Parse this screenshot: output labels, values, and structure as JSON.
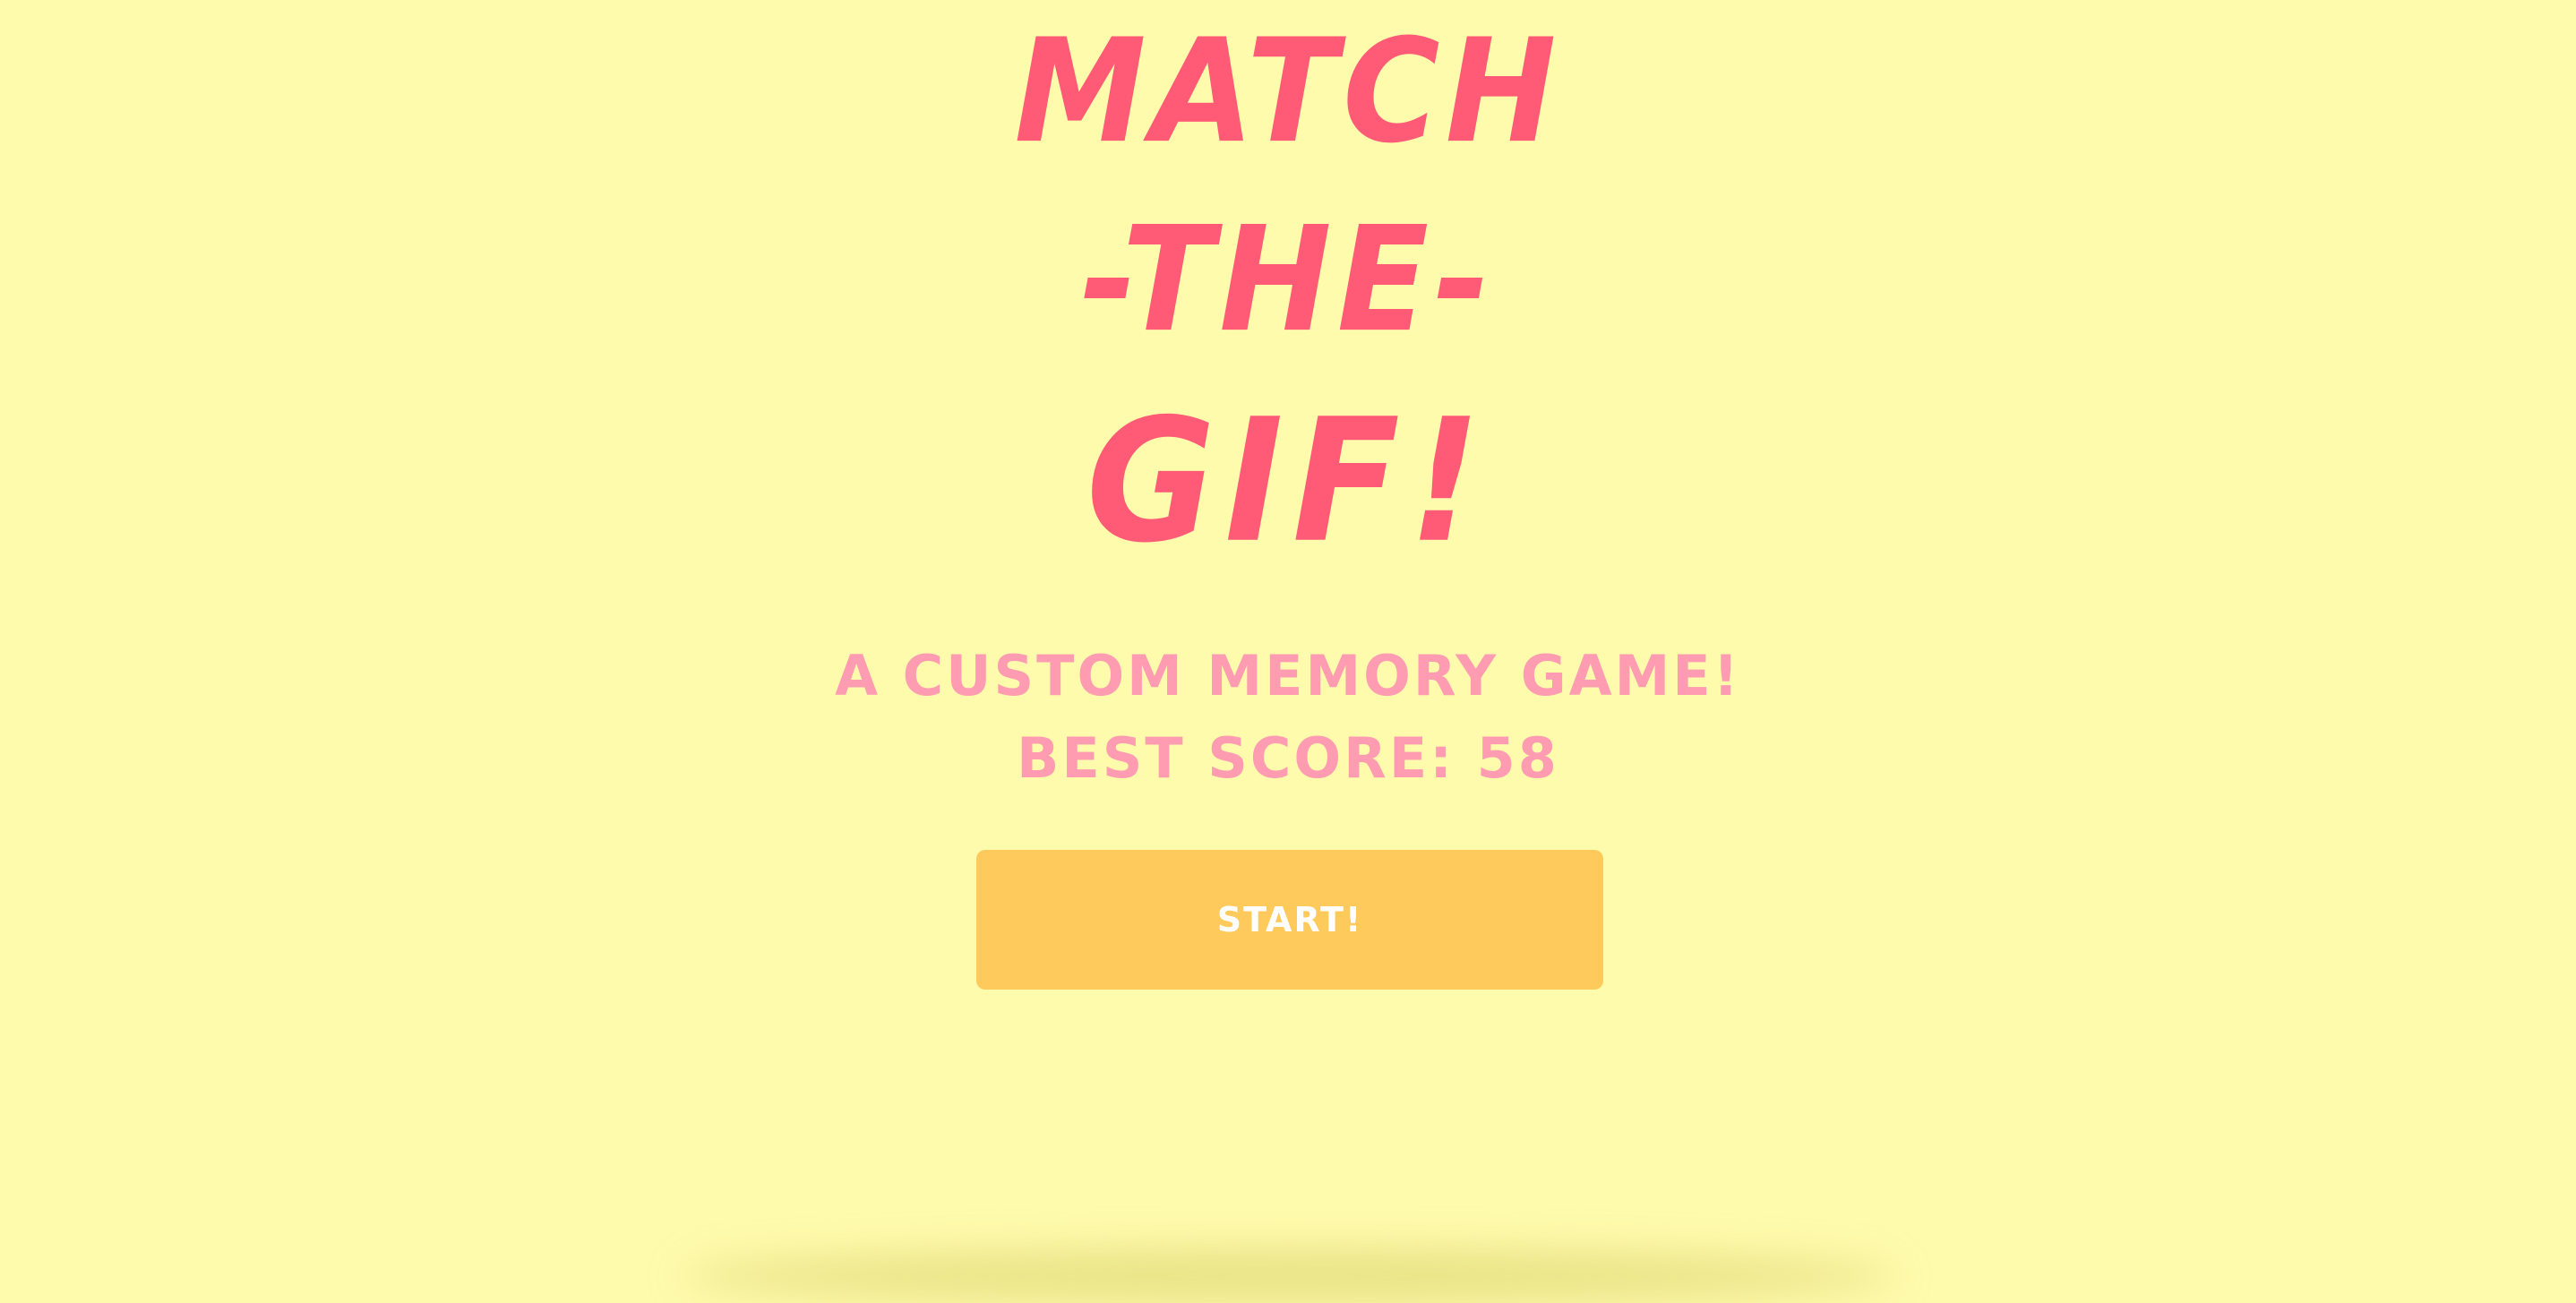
{
  "title": {
    "line1": "MATCH",
    "line2": "-THE-",
    "line3": "GIF!"
  },
  "tagline": "A CUSTOM MEMORY GAME!",
  "best_score": {
    "label": "BEST SCORE: 58",
    "value": 58
  },
  "start_button": {
    "label": "START!"
  },
  "colors": {
    "background": "#fffbad",
    "title": "#ff5a76",
    "subtitle": "#ff9cb1",
    "button": "#ffca5c",
    "button_text": "#ffffff"
  }
}
